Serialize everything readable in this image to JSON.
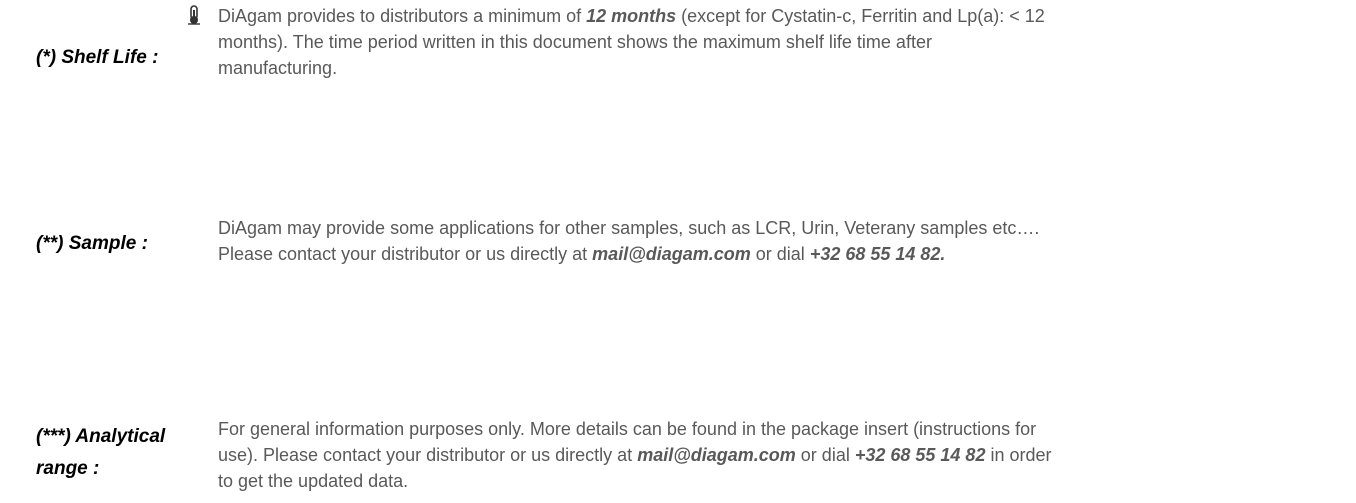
{
  "shelf_life": {
    "label": "(*) Shelf Life :",
    "icon": "thermometer-icon",
    "text_before": "DiAgam provides to distributors a minimum of ",
    "emphasis": "12 months",
    "text_after_line1": "  (except for Cystatin-c, Ferritin and Lp(a): < 12",
    "text_line2": "months). The time period written in this document shows the maximum shelf life time after",
    "text_line3": "manufacturing."
  },
  "sample": {
    "label": "(**) Sample :",
    "line1": "DiAgam may provide some applications for other samples, such as LCR, Urin, Veterany samples etc….",
    "line2_before": "Please contact your distributor or us directly at ",
    "email": "mail@diagam.com",
    "line2_middle": "  or dial ",
    "phone": "+32 68 55 14 82."
  },
  "analytical_range": {
    "label_line1": "(***) Analytical",
    "label_line2": "range :",
    "line1": "For general information purposes only. More details can be found in the package insert (instructions for",
    "line2_before": "use).  Please contact your distributor or us directly at ",
    "email": "mail@diagam.com",
    "line2_middle": "  or dial ",
    "phone": "+32 68 55 14 82",
    "line2_after": "  in order",
    "line3": "to get the updated data."
  }
}
